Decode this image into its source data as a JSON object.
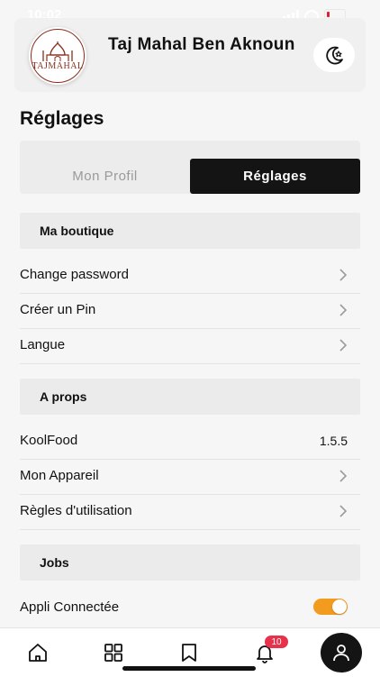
{
  "status": {
    "time": "10:02"
  },
  "header": {
    "logo_text": "TAJMAHAL",
    "shop_name": "Taj Mahal Ben Aknoun"
  },
  "page_title": "Réglages",
  "tabs": {
    "profile": "Mon Profil",
    "settings": "Réglages"
  },
  "sections": {
    "boutique": {
      "title": "Ma boutique",
      "items": [
        "Change password",
        "Créer un Pin",
        "Langue"
      ]
    },
    "about": {
      "title": "A props",
      "app_name": "KoolFood",
      "version": "1.5.5",
      "items": [
        "Mon Appareil",
        "Règles d'utilisation"
      ]
    },
    "jobs": {
      "title": "Jobs",
      "connected_label": "Appli Connectée",
      "connected": true
    }
  },
  "nav": {
    "notification_count": "10",
    "icons": [
      "home-icon",
      "grid-icon",
      "bookmark-icon",
      "bell-icon",
      "user-icon"
    ]
  },
  "colors": {
    "accent": "#f39b1e",
    "dark": "#141414",
    "badge": "#e8314a",
    "logo": "#8b2e1c"
  }
}
